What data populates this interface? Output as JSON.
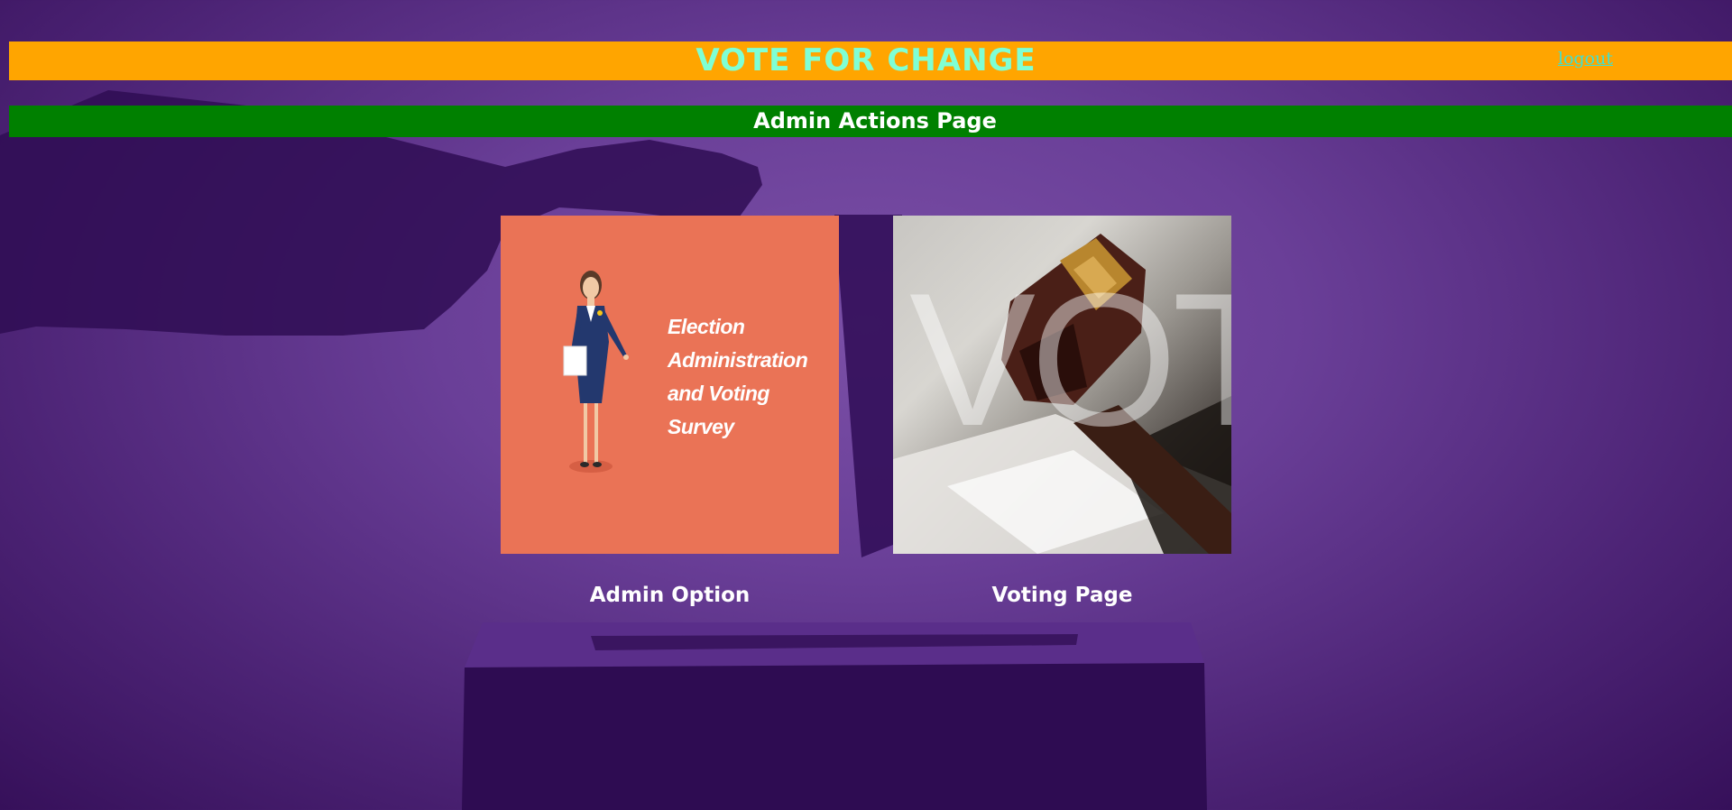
{
  "header": {
    "title": "VOTE FOR CHANGE",
    "logout_label": "logout"
  },
  "subheader": {
    "title": "Admin Actions Page"
  },
  "cards": [
    {
      "label": "Admin Option",
      "image_text": [
        "Election",
        "Administration",
        "and Voting Survey"
      ]
    },
    {
      "label": "Voting Page",
      "image_text": "VOTE"
    }
  ],
  "colors": {
    "header_bg": "#ffa500",
    "header_text": "#7fffd4",
    "logout_link": "#40e0d0",
    "subheader_bg": "#008000",
    "background": "#6a3f98",
    "admin_card_bg": "#ea7356"
  }
}
